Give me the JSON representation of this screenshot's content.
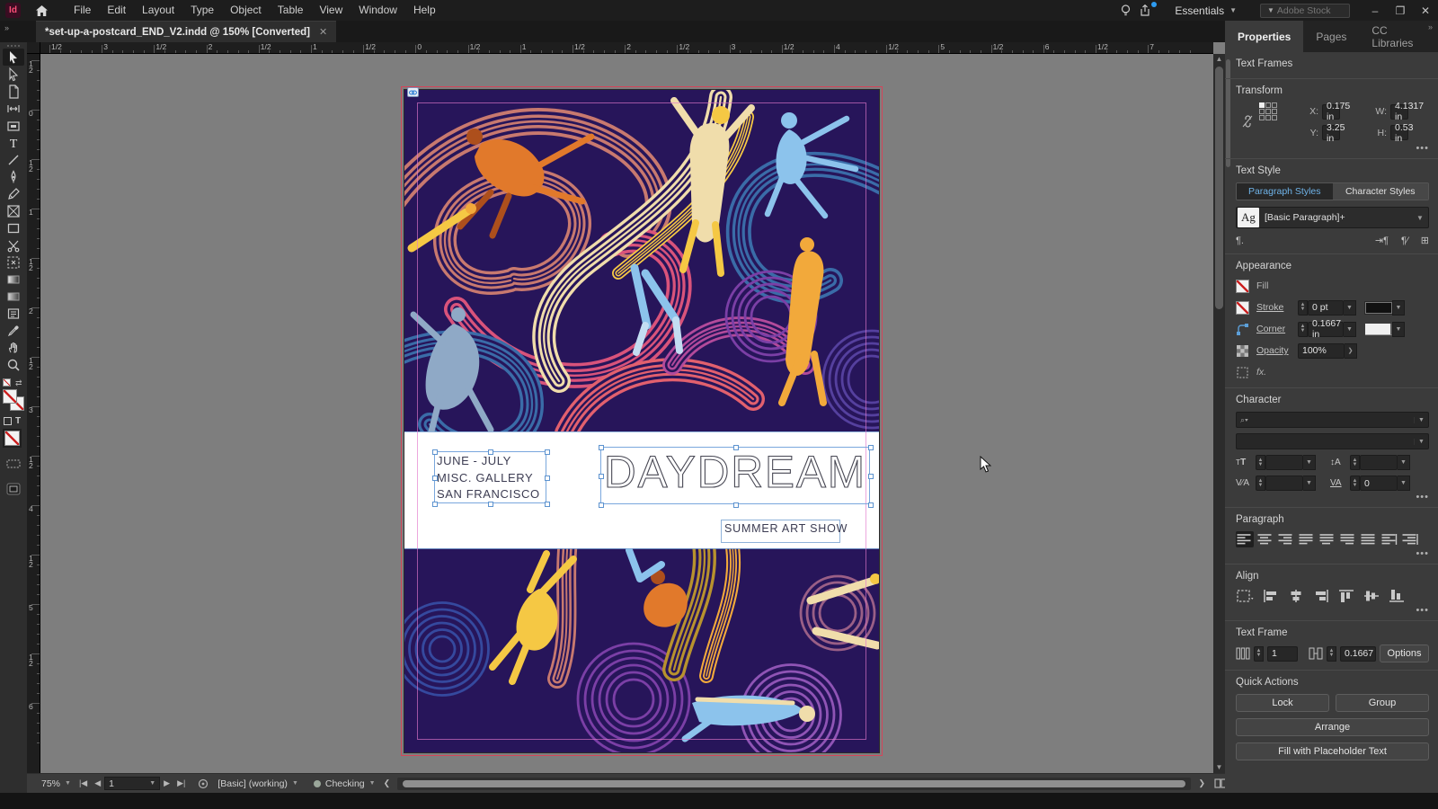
{
  "app": {
    "logo": "Id",
    "menu": [
      "File",
      "Edit",
      "Layout",
      "Type",
      "Object",
      "Table",
      "View",
      "Window",
      "Help"
    ],
    "workspace": "Essentials",
    "search_placeholder": "Adobe Stock",
    "doc_tab": "*set-up-a-postcard_END_V2.indd @ 150% [Converted]",
    "window_controls": [
      "–",
      "❐",
      "✕"
    ]
  },
  "toolbar": {
    "tools": [
      "selection",
      "direct-selection",
      "page",
      "gap",
      "content-collector",
      "type",
      "line",
      "pen",
      "pencil",
      "frame",
      "rectangle",
      "scissors",
      "free-transform",
      "gradient",
      "gradient-feather",
      "note",
      "eyedropper",
      "hand",
      "zoom"
    ],
    "active_tool": "selection"
  },
  "rulers": {
    "horizontal": [
      "1/2",
      "3",
      "1/2",
      "2",
      "1/2",
      "1",
      "1/2",
      "0",
      "1/2",
      "1",
      "1/2",
      "2",
      "1/2",
      "3",
      "1/2",
      "4",
      "1/2",
      "5",
      "1/2",
      "6",
      "1/2",
      "7"
    ],
    "vertical": [
      "1/2",
      "0",
      "1/2",
      "1",
      "1/2",
      "2",
      "1/2",
      "3",
      "1/2",
      "4",
      "1/2",
      "5",
      "1/2",
      "6"
    ]
  },
  "panel": {
    "tabs": [
      "Properties",
      "Pages",
      "CC Libraries"
    ],
    "active_tab": "Properties",
    "selection_type_label": "Text Frames",
    "transform": {
      "title": "Transform",
      "x_label": "X:",
      "x_value": "0.175 in",
      "y_label": "Y:",
      "y_value": "3.25 in",
      "w_label": "W:",
      "w_value": "4.1317 in",
      "h_label": "H:",
      "h_value": "0.53 in"
    },
    "text_style": {
      "title": "Text Style",
      "tab_paragraph": "Paragraph Styles",
      "tab_character": "Character Styles",
      "sample": "Ag",
      "style_name": "[Basic Paragraph]+"
    },
    "appearance": {
      "title": "Appearance",
      "fill_label": "Fill",
      "stroke_label": "Stroke",
      "stroke_value": "0 pt",
      "corner_label": "Corner",
      "corner_value": "0.1667 in",
      "opacity_label": "Opacity",
      "opacity_value": "100%",
      "fx_label": "fx."
    },
    "character": {
      "title": "Character",
      "tracking_value": "0"
    },
    "paragraph": {
      "title": "Paragraph"
    },
    "align": {
      "title": "Align"
    },
    "text_frame": {
      "title": "Text Frame",
      "columns_value": "1",
      "inset_value": "0.1667",
      "options_label": "Options"
    },
    "quick_actions": {
      "title": "Quick Actions",
      "lock": "Lock",
      "group": "Group",
      "arrange": "Arrange",
      "fill_placeholder": "Fill with Placeholder Text"
    }
  },
  "statusbar": {
    "zoom": "75%",
    "page": "1",
    "preset": "[Basic] (working)",
    "status": "Checking"
  },
  "document": {
    "texts": {
      "dates": "JUNE - JULY",
      "gallery": "MISC. GALLERY",
      "city": "SAN FRANCISCO",
      "title": "DAYDREAM",
      "subtitle": "SUMMER ART SHOW"
    }
  },
  "artwork": {
    "palette": {
      "navy": "#27155a",
      "salmon": "#c8796f",
      "rose": "#d9537b",
      "coral": "#e2606e",
      "orange": "#e1792b",
      "orange_dark": "#ad4f1c",
      "amber": "#f2a93b",
      "yellow": "#f5c844",
      "cream": "#f0ddab",
      "light_blue": "#8cc3ec",
      "pale_blue": "#c3ddf2",
      "steel_blue": "#3a6ca8",
      "slate_blue": "#8fa9c6",
      "indigo": "#35499e",
      "purple": "#7b3fa6",
      "grape": "#8f54b5",
      "violet": "#55409e",
      "magenta": "#b34a9b",
      "mauve": "#9a5f86",
      "olive_gold": "#b8922e"
    },
    "ui_accent": "#6fb3e8"
  }
}
